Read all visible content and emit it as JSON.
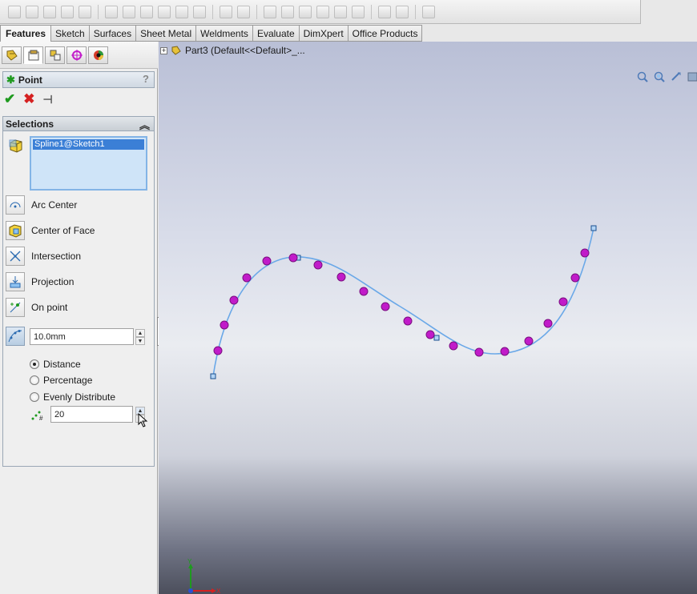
{
  "commandmanager": {
    "tabs": [
      "Features",
      "Sketch",
      "Surfaces",
      "Sheet Metal",
      "Weldments",
      "Evaluate",
      "DimXpert",
      "Office Products"
    ],
    "active_tab": "Features"
  },
  "manager_tabs": [
    "featuremanager-icon",
    "propertymanager-icon",
    "configurationmanager-icon",
    "dimxpert-manager-icon",
    "display-manager-icon"
  ],
  "property_manager": {
    "title": "Point",
    "help": "?",
    "actions": {
      "ok": "✔",
      "cancel": "✖",
      "pin": "⊣"
    }
  },
  "selections": {
    "header": "Selections",
    "selected_item": "Spline1@Sketch1"
  },
  "options": [
    {
      "label": "Arc Center",
      "icon": "arc-center-icon"
    },
    {
      "label": "Center of Face",
      "icon": "center-of-face-icon"
    },
    {
      "label": "Intersection",
      "icon": "intersection-icon"
    },
    {
      "label": "Projection",
      "icon": "projection-icon"
    },
    {
      "label": "On point",
      "icon": "on-point-icon"
    }
  ],
  "distance": {
    "value": "10.0mm",
    "radios": [
      {
        "label": "Distance",
        "checked": true
      },
      {
        "label": "Percentage",
        "checked": false
      },
      {
        "label": "Evenly Distribute",
        "checked": false
      }
    ],
    "count": "20"
  },
  "viewport": {
    "tree_label": "Part3  (Default<<Default>_...",
    "axes": {
      "x": "X",
      "y": "Y"
    }
  },
  "colors": {
    "spline": "#6aa8e8",
    "point": "#c11bc9",
    "ok": "#1f9a1f",
    "cancel": "#d52121"
  }
}
